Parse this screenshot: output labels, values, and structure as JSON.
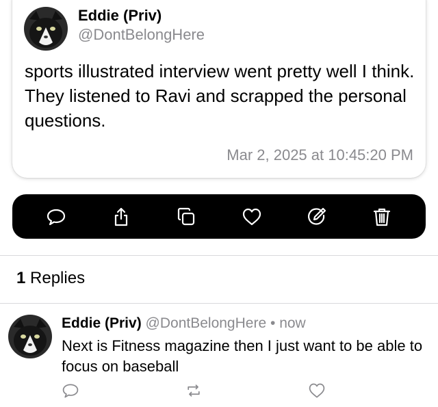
{
  "post": {
    "author_name": "Eddie (Priv)",
    "author_handle": "@DontBelongHere",
    "text": "sports illustrated interview went pretty well I think. They listened to Ravi and scrapped the personal questions.",
    "timestamp": "Mar 2, 2025 at 10:45:20 PM"
  },
  "actions": [
    {
      "icon": "reply-icon"
    },
    {
      "icon": "share-icon"
    },
    {
      "icon": "copy-icon"
    },
    {
      "icon": "heart-icon"
    },
    {
      "icon": "edit-icon"
    },
    {
      "icon": "trash-icon"
    }
  ],
  "replies": {
    "count": "1",
    "label": "Replies"
  },
  "reply": {
    "author_name": "Eddie (Priv)",
    "author_handle": "@DontBelongHere",
    "separator": "•",
    "time": "now",
    "text": "Next is Fitness magazine then I just want to be able to focus on baseball"
  },
  "colors": {
    "secondary_text": "#8a8a8e",
    "action_bar_bg": "#000000",
    "reply_icon_color": "#8a8a8e"
  }
}
